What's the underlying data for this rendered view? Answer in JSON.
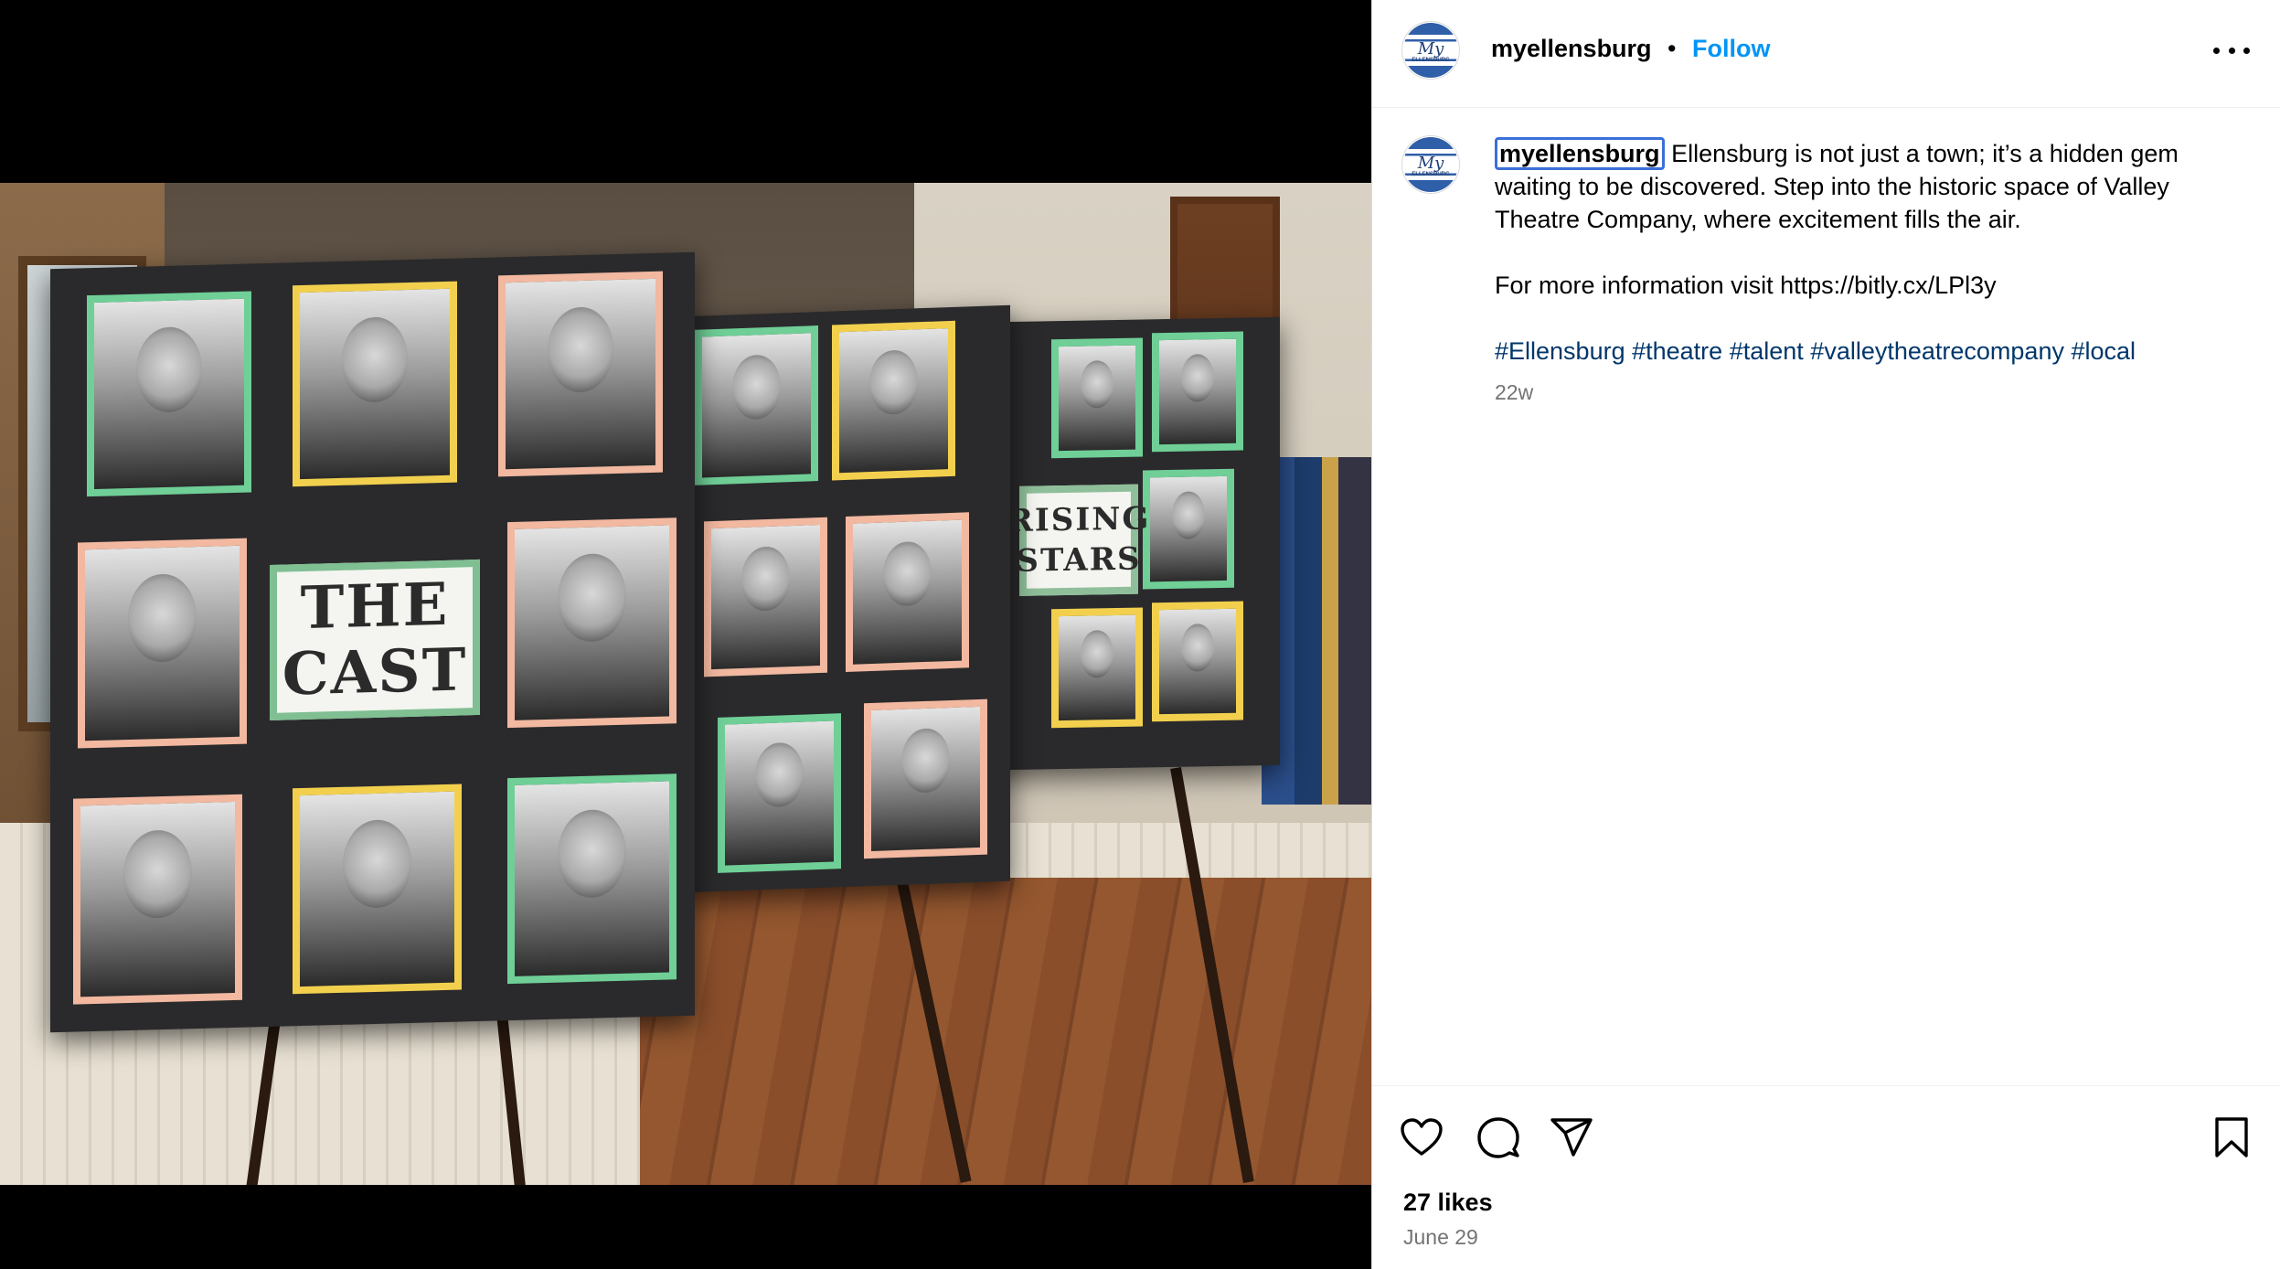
{
  "post": {
    "username": "myellensburg",
    "separator": "•",
    "follow_label": "Follow",
    "more_icon": "more-horizontal-icon"
  },
  "avatar": {
    "script": "My",
    "small_text": "ELLENSBURG"
  },
  "photo": {
    "sign_the_cast_line1": "THE",
    "sign_the_cast_line2": "CAST",
    "sign_rising_stars_line1": "RISING",
    "sign_rising_stars_line2": "STARS"
  },
  "caption": {
    "username": "myellensburg",
    "text": "Ellensburg is not just a town; it’s a hidden gem waiting to be discovered. Step into the historic space of Valley Theatre Company, where excitement fills the air.",
    "info": "For more information visit https://bitly.cx/LPl3y",
    "hashtags": [
      "#Ellensburg",
      "#theatre",
      "#talent",
      "#valleytheatrecompany",
      "#local"
    ],
    "time_ago": "22w"
  },
  "actions": {
    "like_icon": "heart-icon",
    "comment_icon": "comment-icon",
    "share_icon": "send-icon",
    "save_icon": "bookmark-icon",
    "likes": "27 likes",
    "date": "June 29"
  }
}
